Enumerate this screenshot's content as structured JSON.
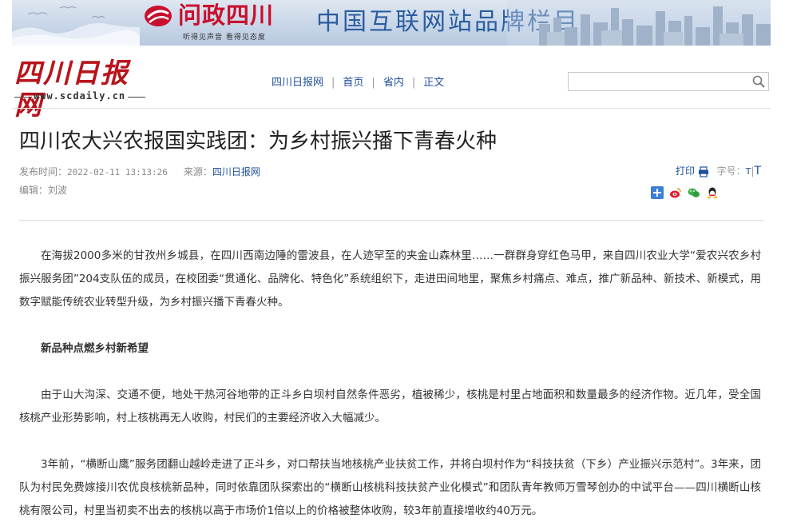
{
  "banner": {
    "logo_text": "问政四川",
    "logo_sub": "听得见声音  看得见态度",
    "slogan": "中国互联网站品牌栏目"
  },
  "site": {
    "logo_cn": "四川日报网",
    "logo_url": "www.scdaily.cn"
  },
  "breadcrumb": [
    "四川日报网",
    "首页",
    "省内",
    "正文"
  ],
  "search": {
    "value": ""
  },
  "article": {
    "title": "四川农大兴农报国实践团：为乡村振兴播下青春火种",
    "publish_label": "发布时间：",
    "publish_time": "2022-02-11 13:13:26",
    "source_label": "来源：",
    "source": "四川日报网",
    "editor_label": "编辑：",
    "editor": "刘波"
  },
  "tools": {
    "print_label": "打印",
    "font_label": "字号：",
    "font_small": "T",
    "font_large": "T"
  },
  "share": [
    "plus-share",
    "weibo",
    "wechat",
    "qq"
  ],
  "paragraphs": [
    "在海拔2000多米的甘孜州乡城县，在四川西南边陲的雷波县，在人迹罕至的夹金山森林里……一群群身穿红色马甲，来自四川农业大学“爱农兴农乡村振兴服务团”204支队伍的成员，在校团委“贯通化、品牌化、特色化”系统组织下，走进田间地里，聚焦乡村痛点、难点，推广新品种、新技术、新模式，用数字赋能传统农业转型升级，为乡村振兴播下青春火种。",
    "新品种点燃乡村新希望",
    "由于山大沟深、交通不便，地处干热河谷地带的正斗乡白坝村自然条件恶劣，植被稀少，核桃是村里占地面积和数量最多的经济作物。近几年，受全国核桃产业形势影响，村上核桃再无人收购，村民们的主要经济收入大幅减少。",
    "3年前，“横断山鹰”服务团翻山越岭走进了正斗乡，对口帮扶当地核桃产业扶贫工作，并将白坝村作为“科技扶贫（下乡）产业振兴示范村”。3年来，团队为村民免费嫁接川农优良核桃新品种，同时依靠团队探索出的“横断山核桃科技扶贫产业化模式”和团队青年教师万雪琴创办的中试平台——四川横断山核桃有限公司，村里当初卖不出去的核桃以高于市场价1倍以上的价格被整体收购，较3年前直接增收约40万元。"
  ],
  "colors": {
    "brand_red": "#c8102e",
    "link_blue": "#1f4f9c",
    "slogan_blue": "#2a5d9f"
  }
}
